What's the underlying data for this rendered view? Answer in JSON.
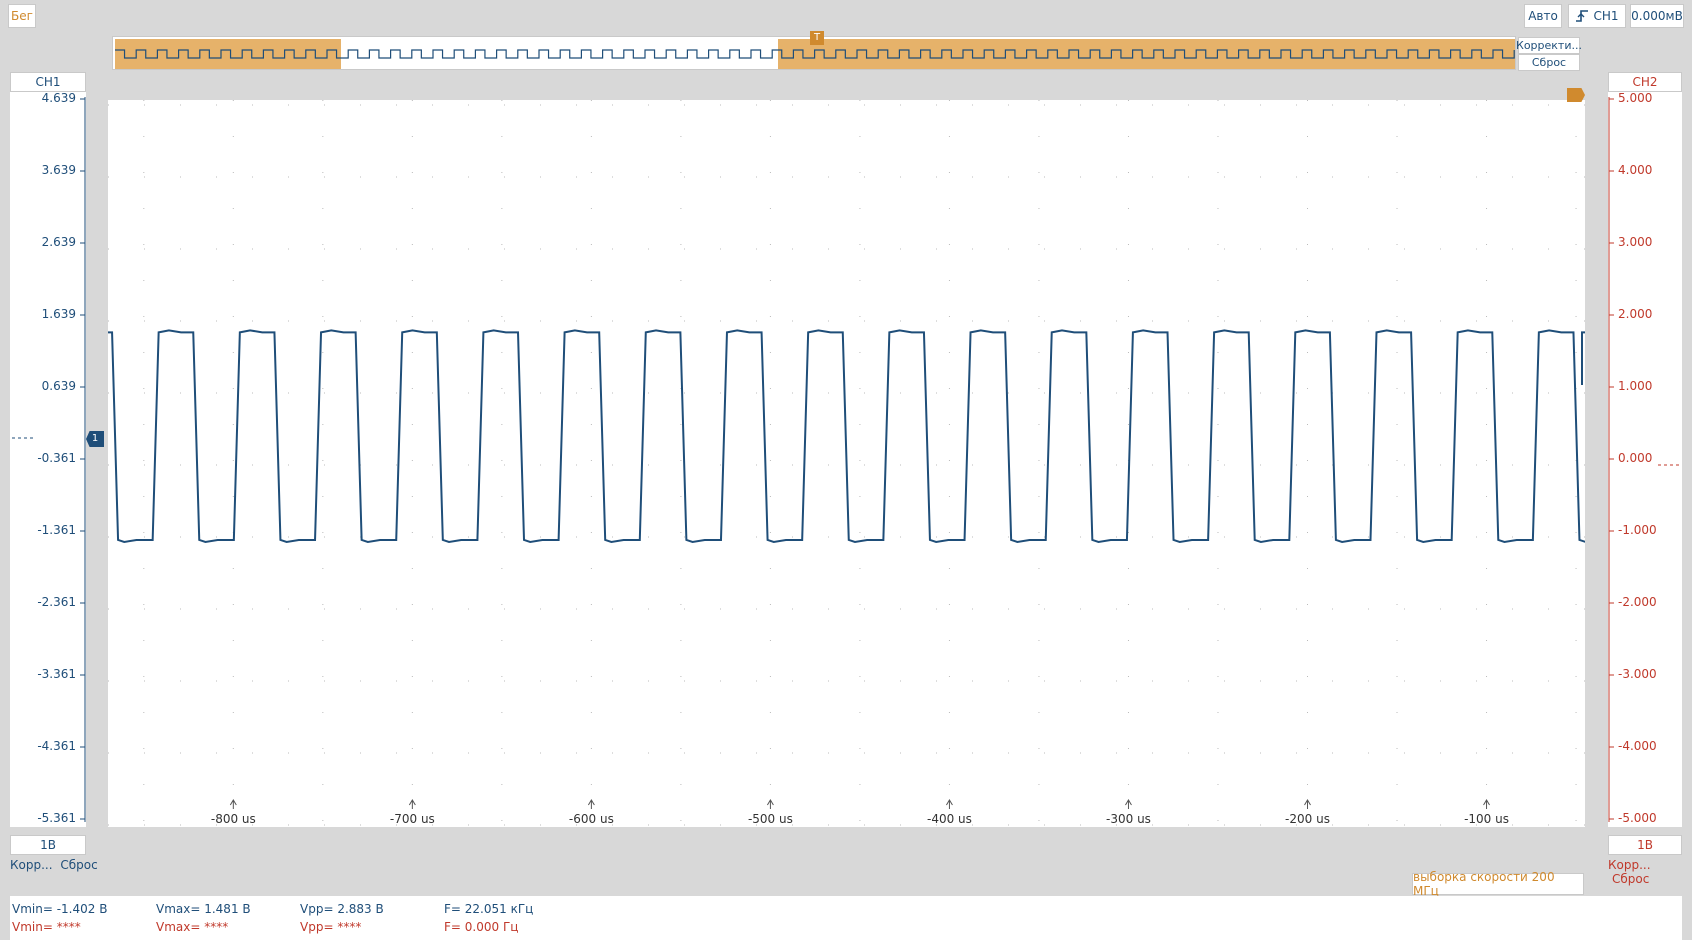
{
  "toolbar": {
    "run_state": "Бег",
    "mode": "Авто",
    "trigger_source": "CH1",
    "trigger_level": "0.000мВ"
  },
  "overview": {
    "correct_label": "Корректи...",
    "reset_label": "Сброс",
    "trigger_marker": "T"
  },
  "ch1": {
    "name": "CH1",
    "scale": "1В",
    "correct_label": "Корр...",
    "reset_label": "Сброс",
    "ticks": [
      "4.639",
      "3.639",
      "2.639",
      "1.639",
      "0.639",
      "-0.361",
      "-1.361",
      "-2.361",
      "-3.361",
      "-4.361",
      "-5.361"
    ],
    "ground_marker": "1",
    "color": "#1f4e79"
  },
  "ch2": {
    "name": "CH2",
    "scale": "1В",
    "correct_label": "Корр...",
    "reset_label": "Сброс",
    "ticks": [
      "5.000",
      "4.000",
      "3.000",
      "2.000",
      "1.000",
      "0.000",
      "-1.000",
      "-2.000",
      "-3.000",
      "-4.000",
      "-5.000"
    ],
    "color": "#c0392b"
  },
  "time_axis": {
    "labels": [
      "-800 us",
      "-700 us",
      "-600 us",
      "-500 us",
      "-400 us",
      "-300 us",
      "-200 us",
      "-100 us"
    ]
  },
  "sample_rate": "выборка скорости 200 МГц",
  "measurements": {
    "ch1": {
      "vmin": "Vmin= -1.402 В",
      "vmax": "Vmax= 1.481 В",
      "vpp": "Vpp= 2.883 В",
      "freq": "F= 22.051 кГц"
    },
    "ch2": {
      "vmin": "Vmin= ****",
      "vmax": "Vmax= ****",
      "vpp": "Vpp= ****",
      "freq": "F= 0.000 Гц"
    }
  },
  "waveform": {
    "channel": "CH1",
    "high_v": 1.481,
    "low_v": -1.402,
    "frequency_khz": 22.051,
    "x_range_us": [
      -870,
      -45
    ]
  }
}
